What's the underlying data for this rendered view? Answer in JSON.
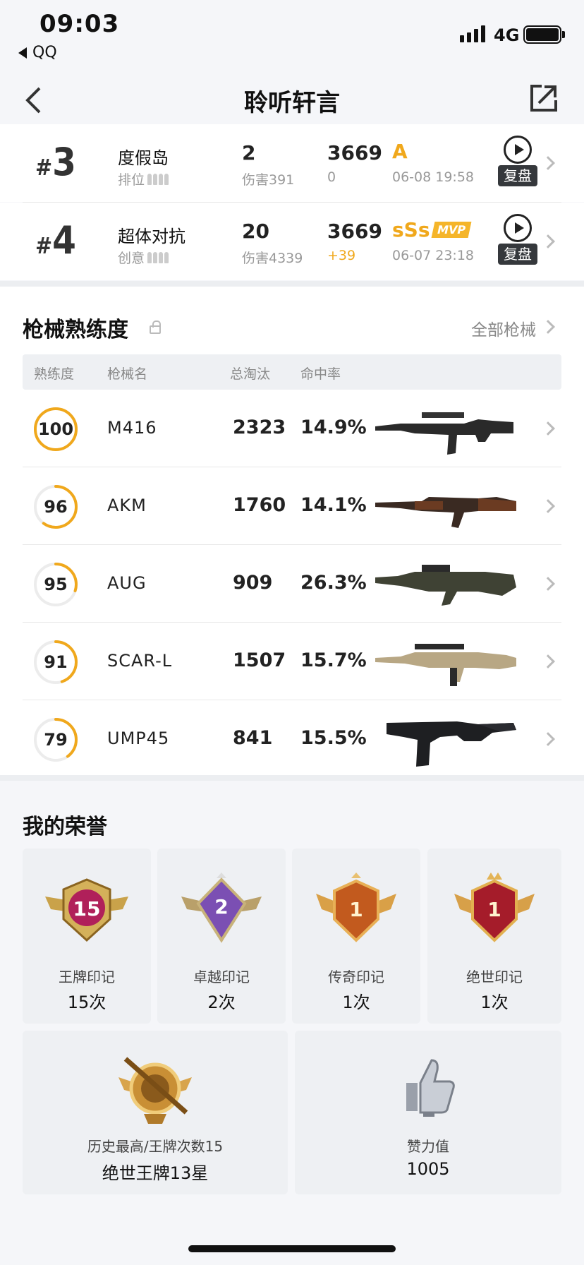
{
  "status_bar": {
    "time": "09:03",
    "back_app": "QQ",
    "network": "4G"
  },
  "nav": {
    "title": "聆听轩言"
  },
  "matches": [
    {
      "hash": "#",
      "rank": "3",
      "mode": "度假岛",
      "sub": "排位",
      "kills": "2",
      "damage": "伤害391",
      "score": "3669",
      "delta": "0",
      "grade": "A",
      "mvp": "",
      "date": "06-08 19:58",
      "replay_label": "复盘"
    },
    {
      "hash": "#",
      "rank": "4",
      "mode": "超体对抗",
      "sub": "创意",
      "kills": "20",
      "damage": "伤害4339",
      "score": "3669",
      "delta": "+39",
      "grade": "sSs",
      "mvp": "MVP",
      "date": "06-07 23:18",
      "replay_label": "复盘"
    }
  ],
  "weapons": {
    "title": "枪械熟练度",
    "all_link": "全部枪械",
    "headers": {
      "proficiency": "熟练度",
      "name": "枪械名",
      "kills": "总淘汰",
      "hit_rate": "命中率"
    },
    "rows": [
      {
        "proficiency": "100",
        "name": "M416",
        "kills": "2323",
        "hit_rate": "14.9%"
      },
      {
        "proficiency": "96",
        "name": "AKM",
        "kills": "1760",
        "hit_rate": "14.1%"
      },
      {
        "proficiency": "95",
        "name": "AUG",
        "kills": "909",
        "hit_rate": "26.3%"
      },
      {
        "proficiency": "91",
        "name": "SCAR-L",
        "kills": "1507",
        "hit_rate": "15.7%"
      },
      {
        "proficiency": "79",
        "name": "UMP45",
        "kills": "841",
        "hit_rate": "15.5%"
      }
    ],
    "ring_levels": [
      1.0,
      0.6,
      0.3,
      0.45,
      0.4
    ]
  },
  "honors": {
    "title": "我的荣誉",
    "badges": [
      {
        "label": "王牌印记",
        "value": "15次",
        "badge_num": "15"
      },
      {
        "label": "卓越印记",
        "value": "2次",
        "badge_num": "2"
      },
      {
        "label": "传奇印记",
        "value": "1次",
        "badge_num": "1"
      },
      {
        "label": "绝世印记",
        "value": "1次",
        "badge_num": "1"
      }
    ],
    "highest": {
      "label": "历史最高/王牌次数15",
      "value": "绝世王牌13星"
    },
    "likes": {
      "label": "赞力值",
      "value": "1005"
    }
  },
  "colors": {
    "accent": "#f0a81c",
    "ring_track": "#ececec"
  }
}
